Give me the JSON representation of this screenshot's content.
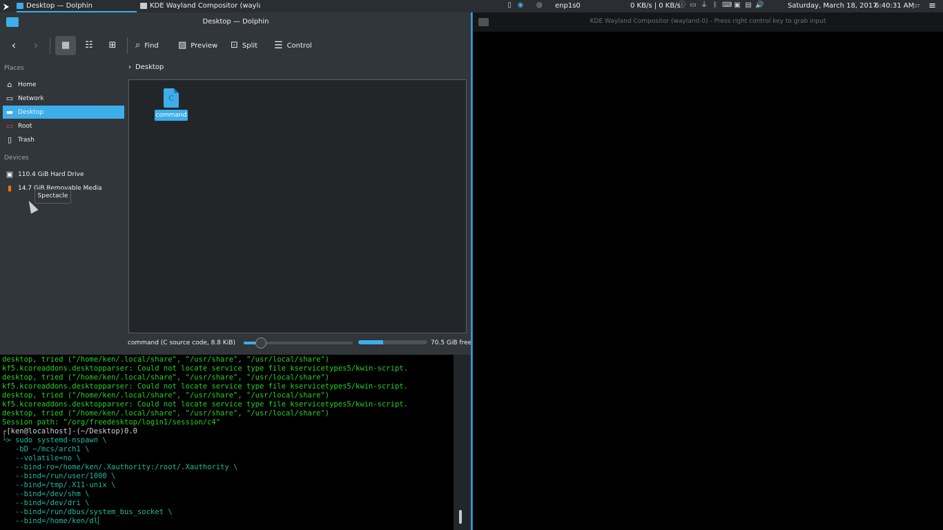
{
  "panel": {
    "tasks": [
      {
        "label": "Desktop — Dolphin",
        "active": true
      },
      {
        "label": "KDE Wayland Compositor (waylan···",
        "active": false
      }
    ],
    "network_label": "enp1s0",
    "network_speed": "0 KB/s | 0 KB/s",
    "date": "Saturday, March 18, 2017",
    "time": "6:40:31 AM",
    "timezone": "JST"
  },
  "dolphin": {
    "window_title": "Desktop — Dolphin",
    "toolbar": {
      "find": "Find",
      "preview": "Preview",
      "split": "Split",
      "control": "Control"
    },
    "places_header": "Places",
    "places": [
      {
        "label": "Home",
        "icon": "home-icon"
      },
      {
        "label": "Network",
        "icon": "network-icon"
      },
      {
        "label": "Desktop",
        "icon": "desktop-icon",
        "selected": true
      },
      {
        "label": "Root",
        "icon": "root-folder-icon"
      },
      {
        "label": "Trash",
        "icon": "trash-icon"
      }
    ],
    "devices_header": "Devices",
    "devices": [
      {
        "label": "110.4 GiB Hard Drive",
        "icon": "hard-drive-icon"
      },
      {
        "label": "14.7 GiB Removable Media",
        "icon": "removable-media-icon"
      }
    ],
    "tooltip": "Spectacle",
    "breadcrumb": "Desktop",
    "files": [
      {
        "name": "command",
        "glyph": "C"
      }
    ],
    "status_text": "command (C source code, 8.8 KiB)",
    "free_space": "70.5 GiB free",
    "disk_used_fraction": 0.36,
    "zoom_fraction": 0.16
  },
  "terminal": {
    "lines": [
      {
        "text": "desktop, tried (\"/home/ken/.local/share\", \"/usr/share\", \"/usr/local/share\")",
        "style": "green"
      },
      {
        "text": "kf5.kcoreaddons.desktopparser: Could not locate service type file kservicetypes5/kwin-script.",
        "style": "green"
      },
      {
        "text": "desktop, tried (\"/home/ken/.local/share\", \"/usr/share\", \"/usr/local/share\")",
        "style": "green"
      },
      {
        "text": "kf5.kcoreaddons.desktopparser: Could not locate service type file kservicetypes5/kwin-script.",
        "style": "green"
      },
      {
        "text": "desktop, tried (\"/home/ken/.local/share\", \"/usr/share\", \"/usr/local/share\")",
        "style": "green"
      },
      {
        "text": "kf5.kcoreaddons.desktopparser: Could not locate service type file kservicetypes5/kwin-script.",
        "style": "green"
      },
      {
        "text": "desktop, tried (\"/home/ken/.local/share\", \"/usr/share\", \"/usr/local/share\")",
        "style": "green"
      },
      {
        "text": "Session path: \"/org/freedesktop/login1/session/c4\"",
        "style": "green"
      },
      {
        "text": "┌[ken@localhost]-(~/Desktop)0.0",
        "style": "white"
      },
      {
        "text": "└> sudo systemd-nspawn \\",
        "style": "cyan"
      },
      {
        "text": "   -bD ~/mcs/arch1 \\",
        "style": "cyan"
      },
      {
        "text": "   --volatile=no \\",
        "style": "cyan"
      },
      {
        "text": "   --bind-ro=/home/ken/.Xauthority:/root/.Xauthority \\",
        "style": "cyan"
      },
      {
        "text": "   --bind=/run/user/1000 \\",
        "style": "cyan"
      },
      {
        "text": "   --bind=/tmp/.X11-unix \\",
        "style": "cyan"
      },
      {
        "text": "   --bind=/dev/shm \\",
        "style": "cyan"
      },
      {
        "text": "   --bind=/dev/dri \\",
        "style": "cyan"
      },
      {
        "text": "   --bind=/run/dbus/system_bus_socket \\",
        "style": "cyan"
      },
      {
        "text": "   --bind=/home/ken/dl▏",
        "style": "cyan"
      }
    ]
  },
  "compositor": {
    "window_title": "KDE Wayland Compositor (wayland-0) - Press right control key to grab input"
  },
  "colors": {
    "accent": "#3daee9",
    "terminal_green": "#22d422",
    "terminal_cyan": "#1abc9c"
  }
}
